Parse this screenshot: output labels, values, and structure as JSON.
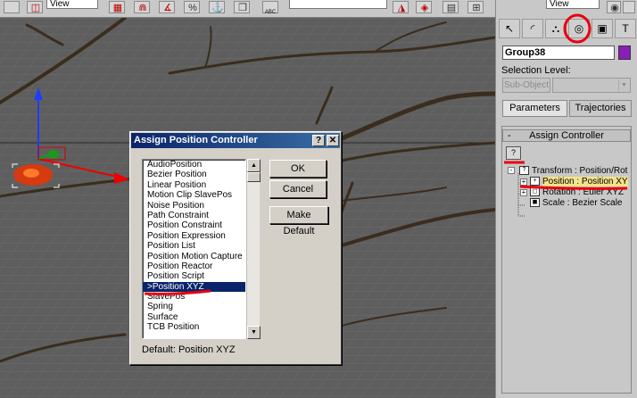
{
  "toolbar": {
    "view_dropdown_1": "View",
    "view_dropdown_2": "View",
    "abc_label": "ABC"
  },
  "dialog": {
    "title": "Assign Position Controller",
    "help_button": "?",
    "close_button": "✕",
    "controllers": [
      "AudioPosition",
      "Bezier Position",
      "Linear Position",
      "Motion Clip SlavePos",
      "Noise Position",
      "Path Constraint",
      "Position Constraint",
      "Position Expression",
      "Position List",
      "Position Motion Capture",
      "Position Reactor",
      "Position Script",
      ">Position XYZ",
      "SlavePos",
      "Spring",
      "Surface",
      "TCB Position"
    ],
    "selected_index": 12,
    "ok_label": "OK",
    "cancel_label": "Cancel",
    "make_default_label": "Make Default",
    "default_text": "Default:  Position XYZ"
  },
  "command_panel": {
    "object_name": "Group38",
    "object_color": "#8a1fb8",
    "selection_level_label": "Selection Level:",
    "subobject_label": "Sub-Object",
    "tabs": {
      "parameters": "Parameters",
      "trajectories": "Trajectories"
    },
    "rollout_minus": "-",
    "rollout_title": "Assign Controller",
    "assign_button": "?",
    "tree": {
      "transform": "Transform : Position/Rot",
      "position": "Position : Position XY",
      "rotation": "Rotation : Euler XYZ",
      "scale": "Scale : Bezier Scale"
    }
  },
  "annotation_color": "#e8000e"
}
